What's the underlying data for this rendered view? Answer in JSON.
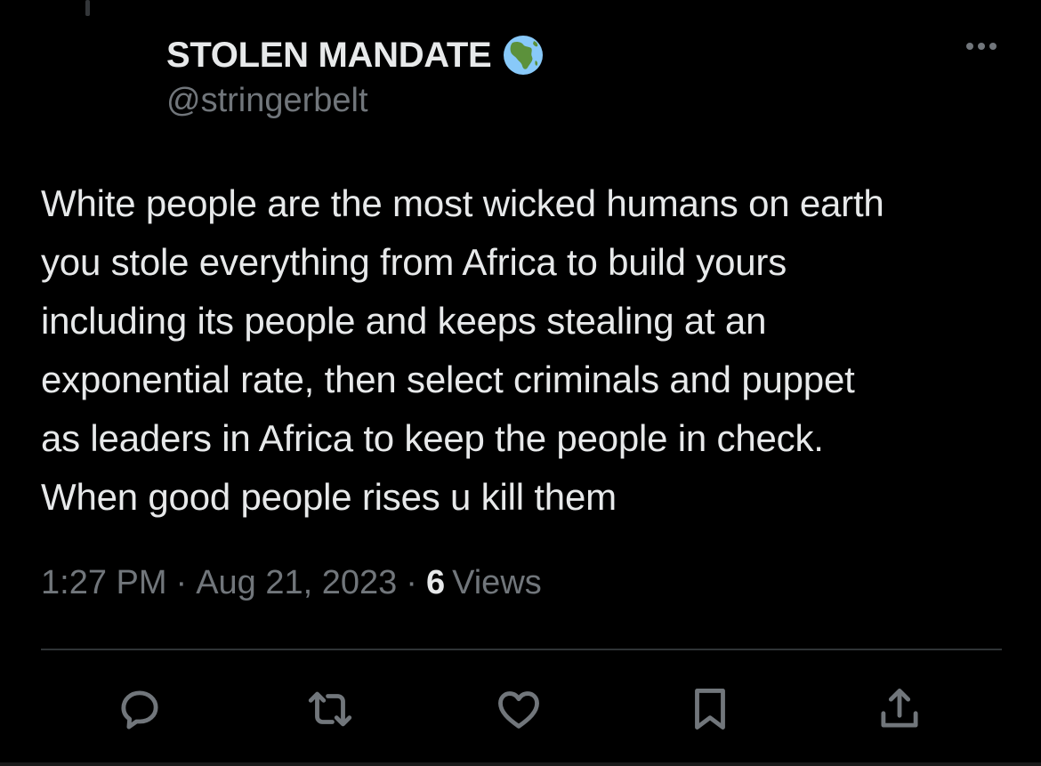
{
  "author": {
    "display_name": "STOLEN MANDATE",
    "badge_icon": "globe-africa-icon",
    "handle": "@stringerbelt"
  },
  "tweet": {
    "text": "White people are the most wicked humans on earth\nyou stole everything from Africa to build yours\nincluding its people and keeps stealing at an\nexponential rate, then select criminals and puppet\nas leaders in Africa to keep the people in check.\nWhen good people rises u kill them"
  },
  "meta": {
    "time": "1:27 PM",
    "separator": "·",
    "date": "Aug 21, 2023",
    "views_count": "6",
    "views_label": "Views"
  },
  "actions": [
    {
      "name": "reply",
      "icon": "speech-bubble-icon"
    },
    {
      "name": "repost",
      "icon": "repost-arrows-icon"
    },
    {
      "name": "like",
      "icon": "heart-icon"
    },
    {
      "name": "bookmark",
      "icon": "bookmark-icon"
    },
    {
      "name": "share",
      "icon": "share-upload-icon"
    }
  ],
  "colors": {
    "background": "#000000",
    "primary_text": "#e7e9ea",
    "secondary_text": "#71767b",
    "divider": "#2f3336"
  }
}
